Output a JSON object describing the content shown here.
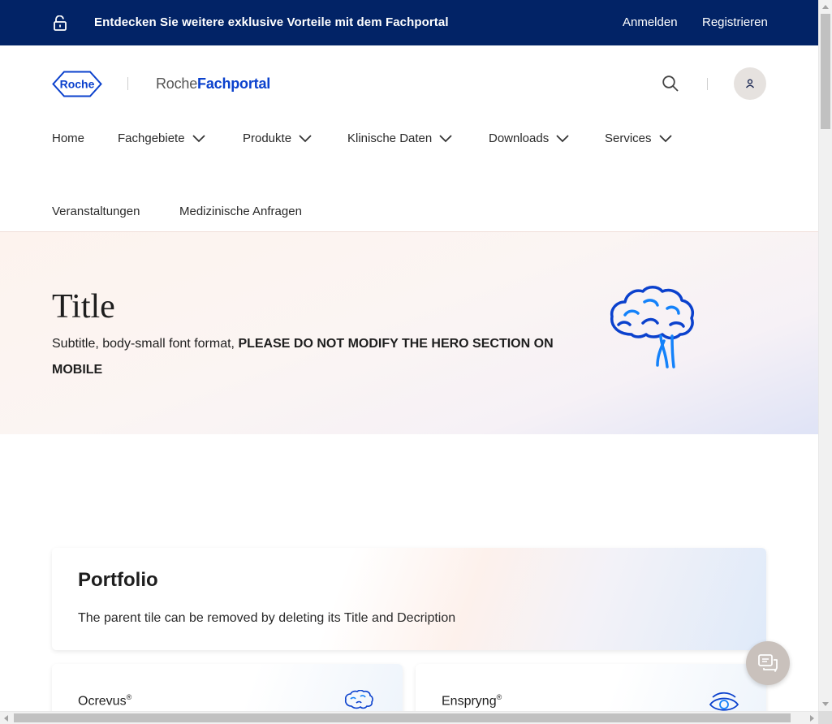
{
  "topbar": {
    "promo": "Entdecken Sie weitere exklusive Vorteile mit dem Fachportal",
    "login": "Anmelden",
    "register": "Registrieren",
    "bg_color": "#022366"
  },
  "header": {
    "logo_text": "Roche",
    "brand_prefix": "Roche",
    "brand_suffix": "Fachportal",
    "brand_color": "#0b41cd"
  },
  "nav": {
    "items": [
      {
        "label": "Home",
        "has_dropdown": false
      },
      {
        "label": "Fachgebiete",
        "has_dropdown": true
      },
      {
        "label": "Produkte",
        "has_dropdown": true
      },
      {
        "label": "Klinische Daten",
        "has_dropdown": true
      },
      {
        "label": "Downloads",
        "has_dropdown": true
      },
      {
        "label": "Services",
        "has_dropdown": true
      },
      {
        "label": "Veranstaltungen",
        "has_dropdown": false
      },
      {
        "label": "Medizinische Anfragen",
        "has_dropdown": false
      }
    ]
  },
  "hero": {
    "title": "Title",
    "subtitle_plain": "Subtitle, body-small font format, ",
    "subtitle_bold": "PLEASE DO NOT MODIFY THE HERO SECTION ON MOBILE",
    "icon": "brain-icon"
  },
  "portfolio": {
    "title": "Portfolio",
    "description": "The parent tile can be removed by deleting its Title and Decription"
  },
  "cards": [
    {
      "name": "Ocrevus",
      "mark": "®",
      "icon": "brain-icon"
    },
    {
      "name": "Enspryng",
      "mark": "®",
      "icon": "eye-icon"
    }
  ],
  "chat": {
    "icon": "chat-icon"
  }
}
